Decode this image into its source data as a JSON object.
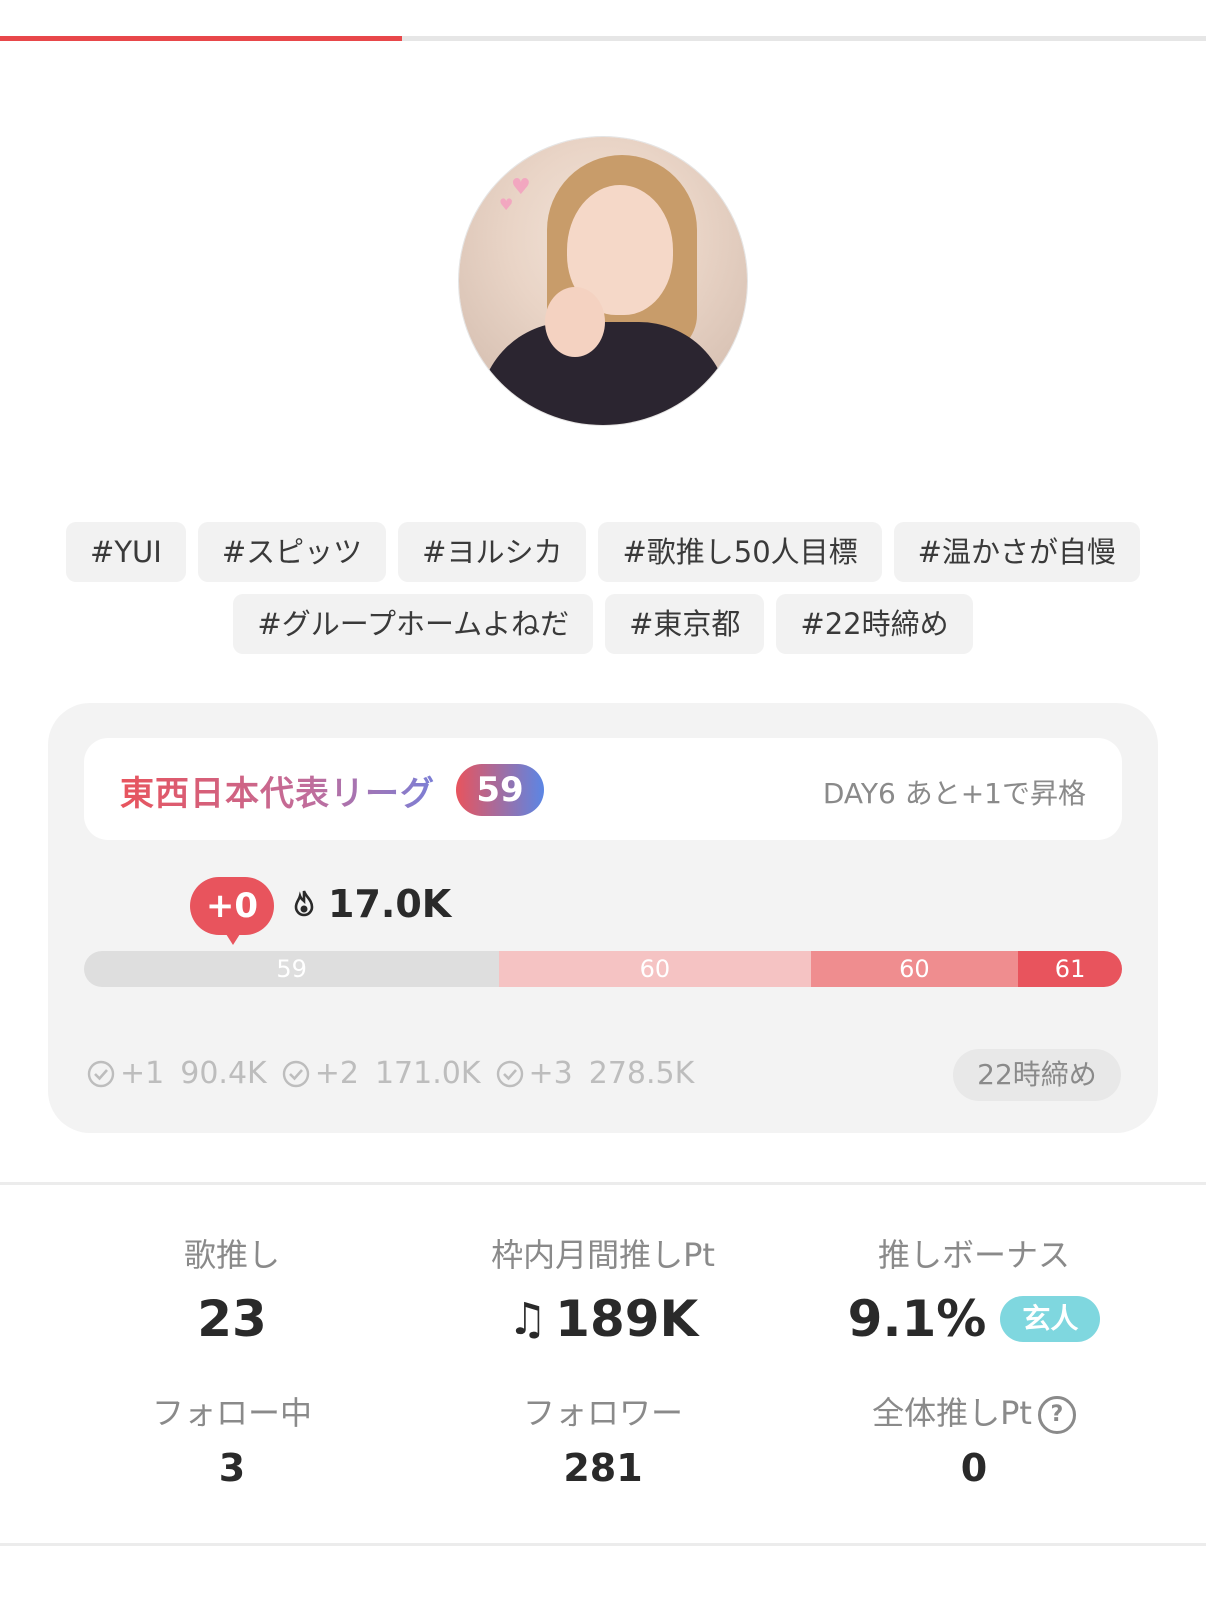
{
  "tab_progress": {
    "fraction": 0.333
  },
  "profile": {
    "avatar": "profile-photo"
  },
  "tags": {
    "row1": [
      "#YUI",
      "#スピッツ",
      "#ヨルシカ",
      "#歌推し50人目標",
      "#温かさが自慢"
    ],
    "row2": [
      "#グループホームよねだ",
      "#東京都",
      "#22時締め"
    ]
  },
  "league": {
    "name": "東西日本代表リーグ",
    "rank": "59",
    "status": "DAY6 あと+1で昇格",
    "delta": "+0",
    "points": "17.0K",
    "bar_segments": [
      {
        "label": "59",
        "fraction": 0.4
      },
      {
        "label": "60",
        "fraction": 0.3
      },
      {
        "label": "60",
        "fraction": 0.2
      },
      {
        "label": "61",
        "fraction": 0.1
      }
    ],
    "thresholds": [
      {
        "label": "+1",
        "value": "90.4K"
      },
      {
        "label": "+2",
        "value": "171.0K"
      },
      {
        "label": "+3",
        "value": "278.5K"
      }
    ],
    "deadline": "22時締め"
  },
  "stats": {
    "song_oshi": {
      "label": "歌推し",
      "value": "23"
    },
    "monthly_pt": {
      "label": "枠内月間推しPt",
      "icon": "music-note-icon",
      "value": "189K"
    },
    "bonus": {
      "label": "推しボーナス",
      "value": "9.1%",
      "badge": "玄人"
    },
    "following": {
      "label": "フォロー中",
      "value": "3"
    },
    "followers": {
      "label": "フォロワー",
      "value": "281"
    },
    "total_pt": {
      "label": "全体推しPt",
      "value": "0"
    }
  },
  "colors": {
    "accent": "#e8545d",
    "badge": "#7fd7df"
  }
}
